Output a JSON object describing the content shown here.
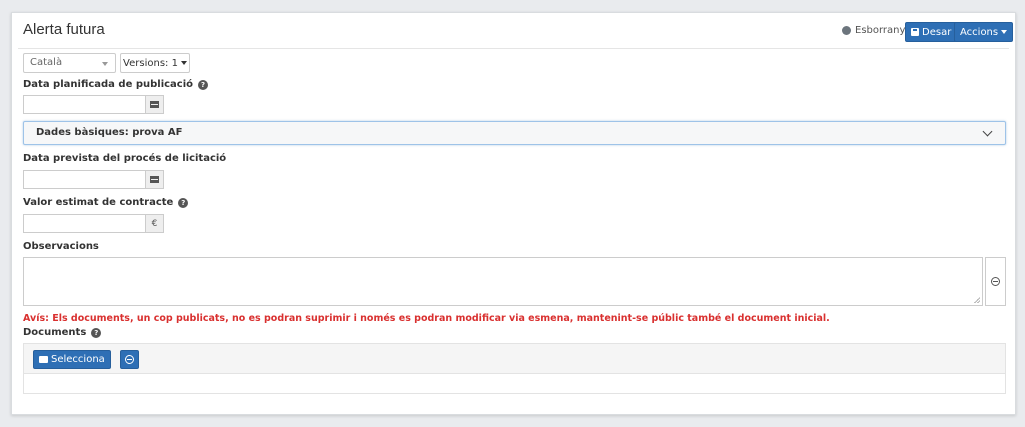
{
  "header": {
    "title": "Alerta futura",
    "status_label": "Esborrany",
    "save_label": "Desar",
    "actions_label": "Accions"
  },
  "language": {
    "selected": "Català",
    "versions_label": "Versions: 1"
  },
  "fields": {
    "planned_date_label": "Data planificada de publicació",
    "basic_data_label": "Dades bàsiques:  prova AF",
    "tender_date_label": "Data prevista del procés de licitació",
    "contract_value_label": "Valor estimat de contracte",
    "currency_symbol": "€",
    "observations_label": "Observacions"
  },
  "warning": "Avís: Els documents, un cop publicats, no es podran suprimir i només es podran modificar via esmena, mantenint-se públic també el document inicial.",
  "documents": {
    "label": "Documents",
    "select_label": "Selecciona"
  },
  "icons": {
    "help": "question-circle-icon",
    "calendar": "calendar-icon",
    "globe": "globe-icon",
    "folder": "folder-icon",
    "save": "floppy-disk-icon",
    "chevron": "chevron-down-icon",
    "status": "circle-icon"
  },
  "colors": {
    "primary": "#2e6fb5",
    "warning": "#d9302f",
    "status_dot": "#6c757d"
  }
}
